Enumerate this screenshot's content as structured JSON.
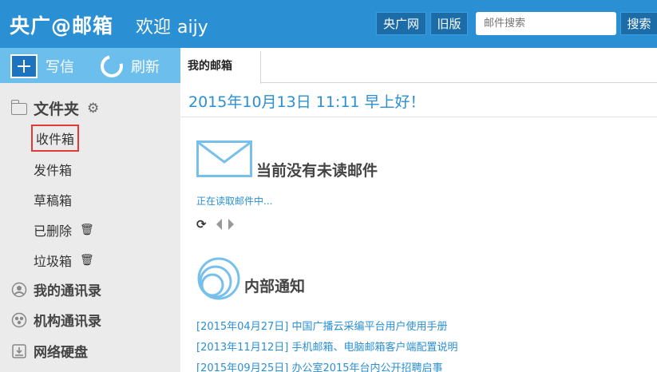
{
  "header": {
    "brand": "央广@邮箱",
    "welcome": "欢迎",
    "username": "aijy",
    "cctv_button": "央广网",
    "old_version_button": "旧版",
    "search_placeholder": "邮件搜索",
    "search_button": "搜索",
    "accent_color": "#2b8fd3"
  },
  "sidebar": {
    "compose_label": "写信",
    "refresh_label": "刷新",
    "folders_title": "文件夹",
    "folders": [
      {
        "label": "收件箱",
        "highlighted": true
      },
      {
        "label": "发件箱"
      },
      {
        "label": "草稿箱"
      },
      {
        "label": "已删除",
        "icon": "trash-icon"
      },
      {
        "label": "垃圾箱",
        "icon": "trash-icon"
      }
    ],
    "sections": [
      {
        "label": "我的通讯录",
        "icon": "person-icon"
      },
      {
        "label": "机构通讯录",
        "icon": "group-icon"
      },
      {
        "label": "网络硬盘",
        "icon": "disk-icon"
      }
    ]
  },
  "main": {
    "tab_label": "我的邮箱",
    "greeting": "2015年10月13日 11:11  早上好！",
    "no_unread": "当前没有未读邮件",
    "loading_text": "正在读取邮件中...",
    "notice_title": "内部通知",
    "notices": [
      "[2015年04月27日] 中国广播云采编平台用户使用手册",
      "[2013年11月12日] 手机邮箱、电脑邮箱客户端配置说明",
      "[2015年09月25日] 办公室2015年台内公开招聘启事"
    ]
  }
}
